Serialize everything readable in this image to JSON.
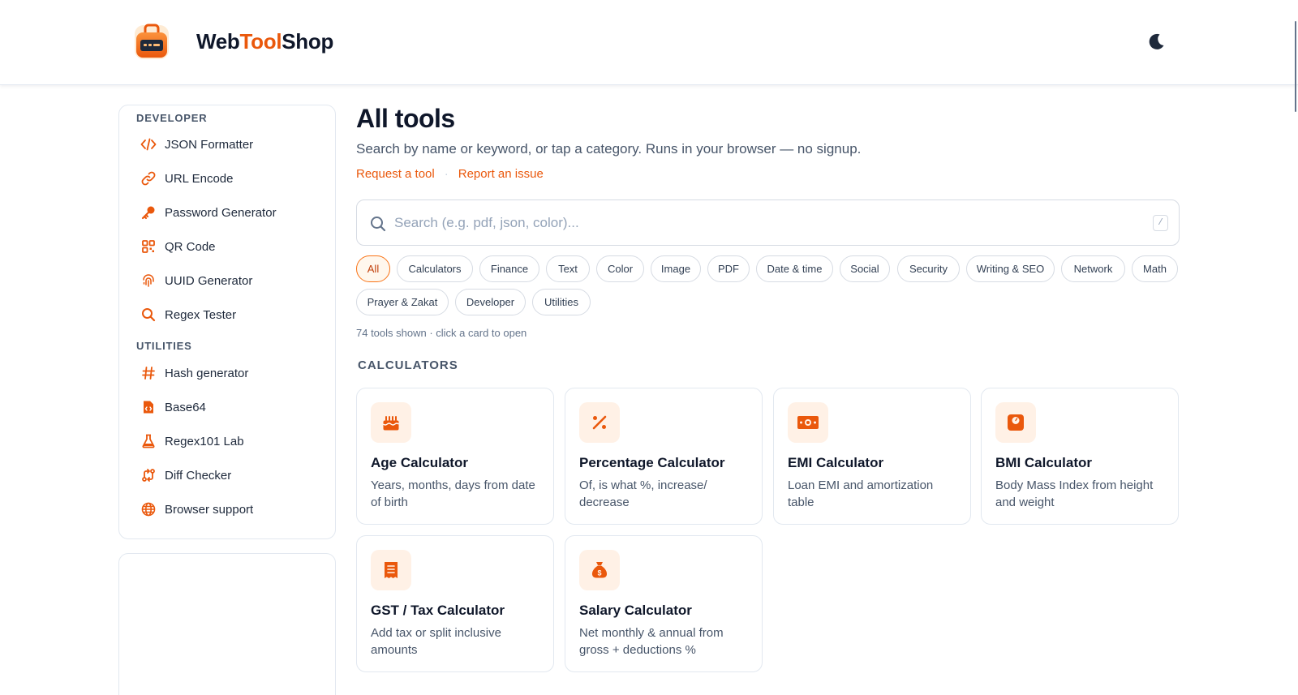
{
  "header": {
    "brand_prefix": "Web",
    "brand_accent": "Tool",
    "brand_suffix": "Shop",
    "theme_icon": "moon-icon"
  },
  "colors": {
    "accent": "#ea580c",
    "accent_soft": "#fff1e6",
    "text": "#0f172a",
    "muted": "#475569",
    "border": "#e2e8f0"
  },
  "sidebar": {
    "sections": [
      {
        "title": "DEVELOPER",
        "items": [
          {
            "label": "JSON Formatter",
            "icon": "code-icon"
          },
          {
            "label": "URL Encode",
            "icon": "link-icon"
          },
          {
            "label": "Password Generator",
            "icon": "key-icon"
          },
          {
            "label": "QR Code",
            "icon": "qr-code-icon"
          },
          {
            "label": "UUID Generator",
            "icon": "fingerprint-icon"
          },
          {
            "label": "Regex Tester",
            "icon": "search-icon"
          }
        ]
      },
      {
        "title": "UTILITIES",
        "items": [
          {
            "label": "Hash generator",
            "icon": "hash-icon"
          },
          {
            "label": "Base64",
            "icon": "file-code-icon"
          },
          {
            "label": "Regex101 Lab",
            "icon": "flask-icon"
          },
          {
            "label": "Diff Checker",
            "icon": "diff-icon"
          },
          {
            "label": "Browser support",
            "icon": "globe-icon"
          }
        ]
      }
    ]
  },
  "main": {
    "title": "All tools",
    "subtitle": "Search by name or keyword, or tap a category. Runs in your browser — no signup.",
    "link_request": "Request a tool",
    "link_separator": "·",
    "link_report": "Report an issue",
    "search": {
      "placeholder": "Search (e.g. pdf, json, color)...",
      "value": "",
      "shortcut": "/"
    },
    "categories": [
      "All",
      "Calculators",
      "Finance",
      "Text",
      "Color",
      "Image",
      "PDF",
      "Date & time",
      "Social",
      "Security",
      "Writing & SEO",
      "Network",
      "Math",
      "Prayer & Zakat",
      "Developer",
      "Utilities"
    ],
    "active_category": "All",
    "count_text": "74 tools shown · click a card to open",
    "section_title": "CALCULATORS",
    "cards": [
      {
        "title": "Age Calculator",
        "desc": "Years, months, days from date of birth",
        "icon": "cake-icon"
      },
      {
        "title": "Percentage Calculator",
        "desc": "Of, is what %, increase/ decrease",
        "icon": "percent-icon"
      },
      {
        "title": "EMI Calculator",
        "desc": "Loan EMI and amortization table",
        "icon": "money-icon"
      },
      {
        "title": "BMI Calculator",
        "desc": "Body Mass Index from height and weight",
        "icon": "scale-icon"
      },
      {
        "title": "GST / Tax Calculator",
        "desc": "Add tax or split inclusive amounts",
        "icon": "receipt-icon"
      },
      {
        "title": "Salary Calculator",
        "desc": "Net monthly & annual from gross + deductions %",
        "icon": "money-bag-icon"
      }
    ]
  }
}
